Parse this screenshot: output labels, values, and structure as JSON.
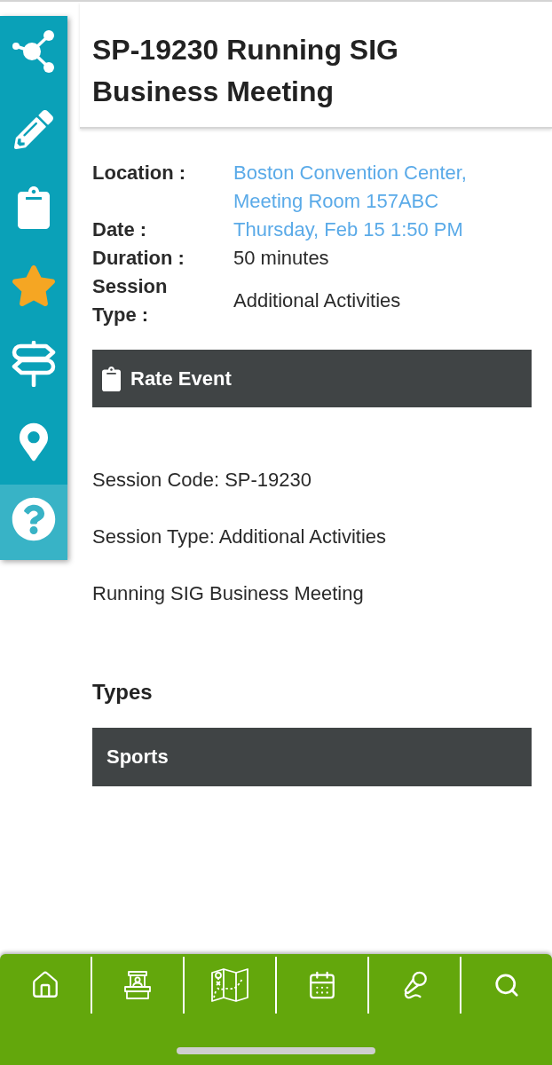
{
  "sidebar": {
    "items": [
      {
        "selected": false
      },
      {
        "selected": false
      },
      {
        "selected": false
      },
      {
        "selected": false
      },
      {
        "selected": false
      },
      {
        "selected": false
      },
      {
        "selected": true
      }
    ]
  },
  "header": {
    "title": "SP-19230 Running SIG Business Meeting"
  },
  "details": [
    {
      "label": "Location :",
      "value": "Boston Convention Center, Meeting Room 157ABC",
      "kind": "link"
    },
    {
      "label": "Date :",
      "value": "Thursday, Feb 15 1:50 PM",
      "kind": "link"
    },
    {
      "label": "Duration :",
      "value": "50 minutes",
      "kind": "text"
    },
    {
      "label": "Session Type :",
      "value": "Additional Activities",
      "kind": "text"
    }
  ],
  "rate_button": {
    "label": "Rate Event"
  },
  "description": [
    "Session Code: SP-19230",
    "Session Type: Additional Activities",
    "Running SIG Business Meeting"
  ],
  "types": {
    "heading": "Types",
    "items": [
      "Sports"
    ]
  }
}
